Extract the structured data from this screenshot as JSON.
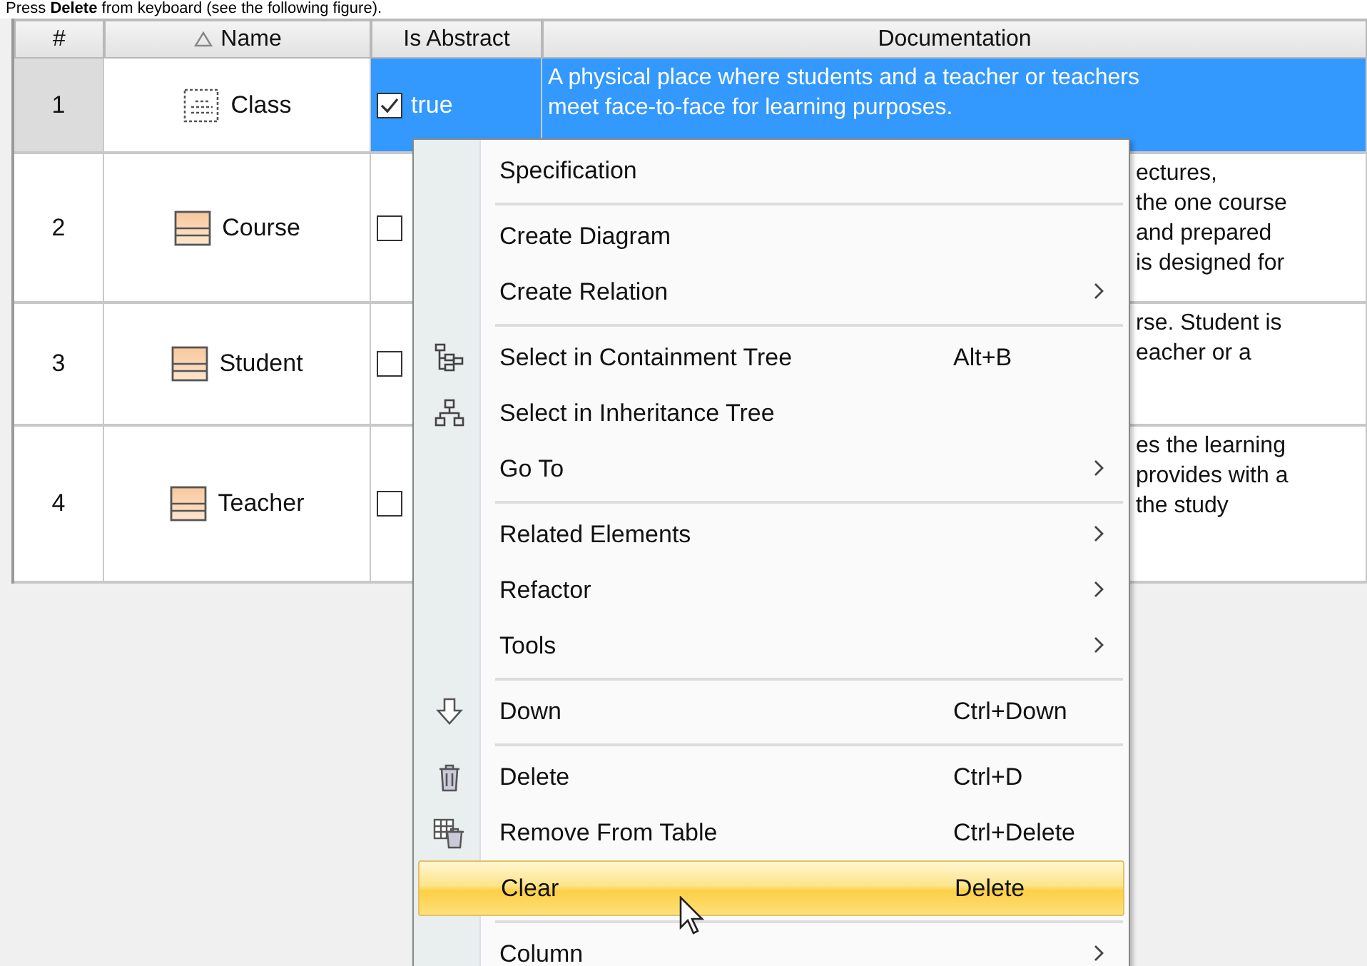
{
  "instruction": "Press **Delete** from keyboard (see the following figure).",
  "table": {
    "columns": [
      {
        "label": "#",
        "sorted": false
      },
      {
        "label": "Name",
        "sorted": true
      },
      {
        "label": "Is Abstract",
        "sorted": false
      },
      {
        "label": "Documentation",
        "sorted": false
      }
    ],
    "rows": [
      {
        "number": "1",
        "name": "Class",
        "is_abstract": true,
        "value": "true",
        "selected": true,
        "documentation": [
          "A physical place where students and a teacher or teachers",
          "meet face-to-face for learning purposes."
        ]
      },
      {
        "number": "2",
        "name": "Course",
        "is_abstract": false,
        "selected": false,
        "documentation": [
          "ectures,",
          "the one course",
          "and prepared",
          "is designed for"
        ]
      },
      {
        "number": "3",
        "name": "Student",
        "is_abstract": false,
        "selected": false,
        "documentation": [
          "rse. Student is",
          "eacher or a"
        ]
      },
      {
        "number": "4",
        "name": "Teacher",
        "is_abstract": false,
        "selected": false,
        "documentation": [
          "es the learning",
          "provides with a",
          "the study"
        ]
      }
    ]
  },
  "context_menu": {
    "items": [
      {
        "kind": "item",
        "label": "Specification",
        "submenu": false,
        "selected": false
      },
      {
        "kind": "separator"
      },
      {
        "kind": "item",
        "label": "Create Diagram",
        "submenu": false,
        "selected": false
      },
      {
        "kind": "item",
        "label": "Create Relation",
        "submenu": true,
        "selected": false
      },
      {
        "kind": "separator"
      },
      {
        "kind": "item",
        "label": "Select in Containment Tree",
        "shortcut": "Alt+B",
        "submenu": false,
        "selected": false
      },
      {
        "kind": "item",
        "label": "Select in Inheritance Tree",
        "submenu": false,
        "selected": false
      },
      {
        "kind": "item",
        "label": "Go To",
        "submenu": true,
        "selected": false
      },
      {
        "kind": "separator"
      },
      {
        "kind": "item",
        "label": "Related Elements",
        "submenu": true,
        "selected": false
      },
      {
        "kind": "item",
        "label": "Refactor",
        "submenu": true,
        "selected": false
      },
      {
        "kind": "item",
        "label": "Tools",
        "submenu": true,
        "selected": false
      },
      {
        "kind": "separator"
      },
      {
        "kind": "item",
        "label": "Down",
        "shortcut": "Ctrl+Down",
        "submenu": false,
        "selected": false
      },
      {
        "kind": "separator"
      },
      {
        "kind": "item",
        "label": "Delete",
        "shortcut": "Ctrl+D",
        "submenu": false,
        "selected": false
      },
      {
        "kind": "item",
        "label": "Remove From Table",
        "shortcut": "Ctrl+Delete",
        "submenu": false,
        "selected": false
      },
      {
        "kind": "item",
        "label": "Clear",
        "shortcut": "Delete",
        "submenu": false,
        "selected": true
      },
      {
        "kind": "separator"
      },
      {
        "kind": "item",
        "label": "Column",
        "submenu": true,
        "selected": false
      }
    ]
  }
}
